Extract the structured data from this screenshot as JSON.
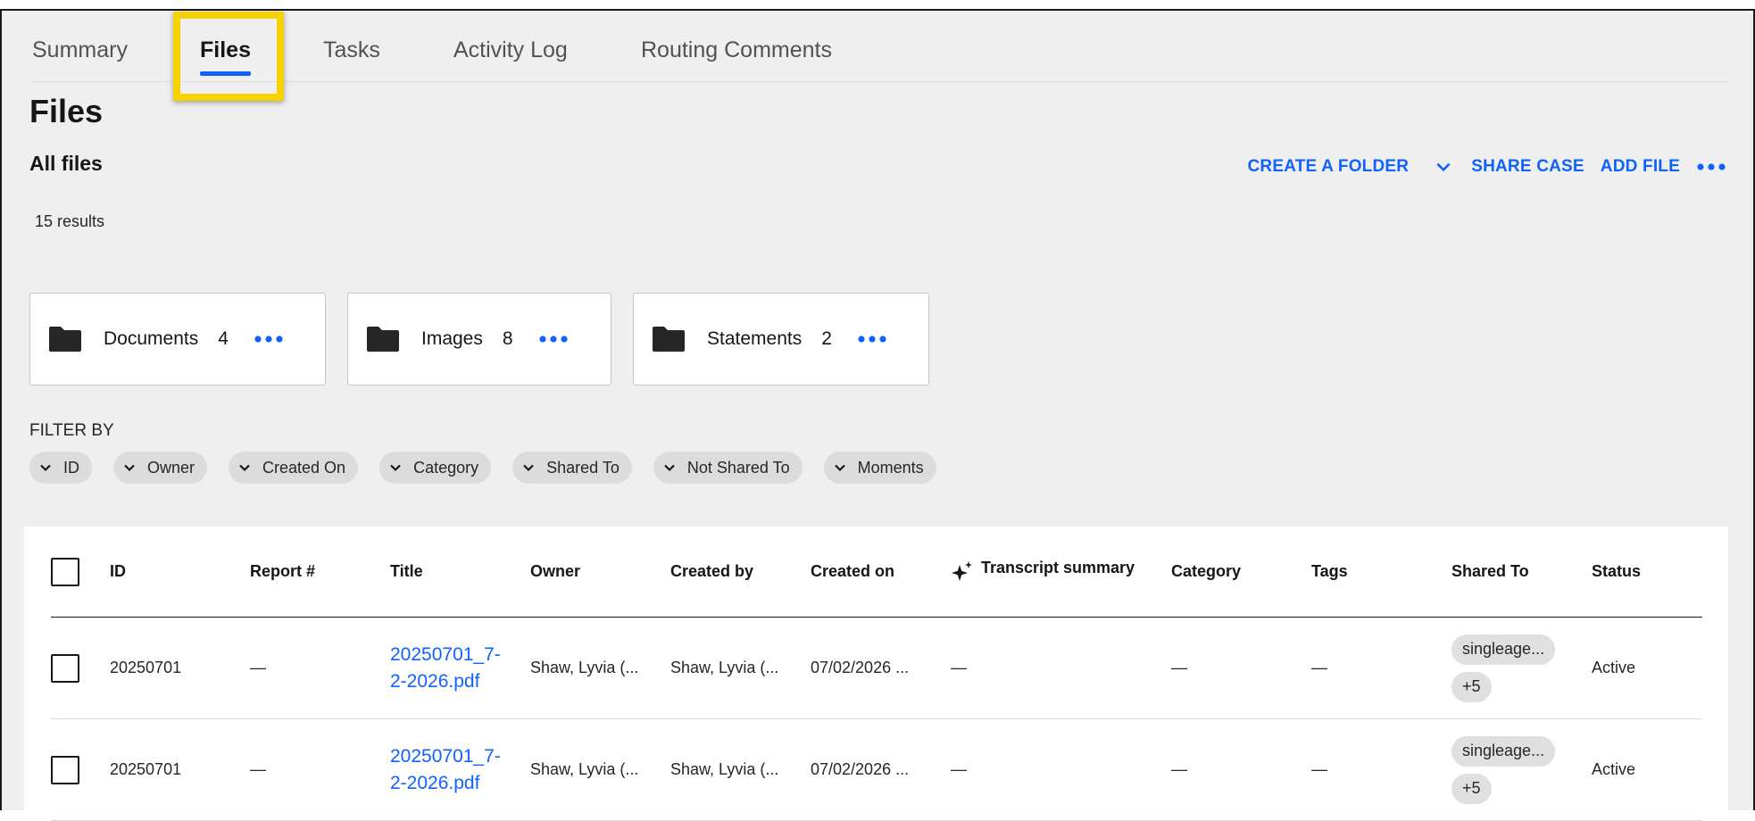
{
  "tabs": [
    {
      "label": "Summary",
      "active": false
    },
    {
      "label": "Files",
      "active": true
    },
    {
      "label": "Tasks",
      "active": false
    },
    {
      "label": "Activity Log",
      "active": false
    },
    {
      "label": "Routing Comments",
      "active": false
    }
  ],
  "page_title": "Files",
  "subtitle": "All files",
  "results_count": "15 results",
  "toolbar": {
    "create_folder": "CREATE A FOLDER",
    "share_case": "SHARE CASE",
    "add_file": "ADD FILE"
  },
  "folders": [
    {
      "name": "Documents",
      "count": "4"
    },
    {
      "name": "Images",
      "count": "8"
    },
    {
      "name": "Statements",
      "count": "2"
    }
  ],
  "filter_label": "FILTER BY",
  "filters": [
    "ID",
    "Owner",
    "Created On",
    "Category",
    "Shared To",
    "Not Shared To",
    "Moments"
  ],
  "table": {
    "columns": [
      "ID",
      "Report #",
      "Title",
      "Owner",
      "Created by",
      "Created on",
      "Transcript summary",
      "Category",
      "Tags",
      "Shared To",
      "Status"
    ],
    "rows": [
      {
        "id": "20250701",
        "report": "—",
        "title_line1": "20250701_7-",
        "title_line2": "2-2026.pdf",
        "owner": "Shaw, Lyvia (...",
        "created_by": "Shaw, Lyvia (...",
        "created_on": "07/02/2026 ...",
        "transcript": "—",
        "category": "—",
        "tags": "—",
        "shared_to": "singleage...",
        "shared_more": "+5",
        "status": "Active"
      },
      {
        "id": "20250701",
        "report": "—",
        "title_line1": "20250701_7-",
        "title_line2": "2-2026.pdf",
        "owner": "Shaw, Lyvia (...",
        "created_by": "Shaw, Lyvia (...",
        "created_on": "07/02/2026 ...",
        "transcript": "—",
        "category": "—",
        "tags": "—",
        "shared_to": "singleage...",
        "shared_more": "+5",
        "status": "Active"
      }
    ]
  },
  "colors": {
    "accent": "#0f62fe",
    "highlight": "#f7d200"
  }
}
